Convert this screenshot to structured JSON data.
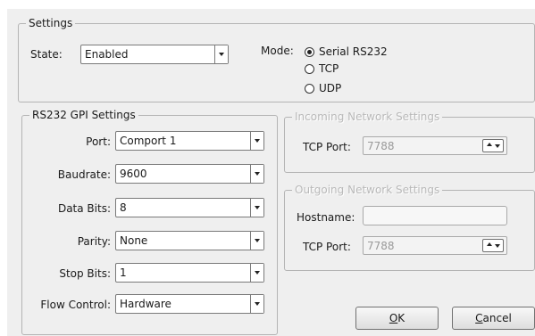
{
  "settings": {
    "legend": "Settings",
    "state_label": "State:",
    "state_value": "Enabled",
    "mode_label": "Mode:",
    "mode_options": [
      "Serial RS232",
      "TCP",
      "UDP"
    ],
    "mode_selected": "Serial RS232"
  },
  "rs232": {
    "legend": "RS232 GPI Settings",
    "fields": [
      {
        "label": "Port:",
        "value": "Comport 1"
      },
      {
        "label": "Baudrate:",
        "value": "9600"
      },
      {
        "label": "Data Bits:",
        "value": "8"
      },
      {
        "label": "Parity:",
        "value": "None"
      },
      {
        "label": "Stop Bits:",
        "value": "1"
      },
      {
        "label": "Flow Control:",
        "value": "Hardware"
      }
    ]
  },
  "incoming": {
    "legend": "Incoming Network Settings",
    "tcp_port_label": "TCP Port:",
    "tcp_port_value": "7788"
  },
  "outgoing": {
    "legend": "Outgoing Network Settings",
    "hostname_label": "Hostname:",
    "hostname_value": "",
    "tcp_port_label": "TCP Port:",
    "tcp_port_value": "7788"
  },
  "buttons": {
    "ok_accel": "O",
    "ok_rest": "K",
    "cancel_accel": "C",
    "cancel_rest": "ancel"
  },
  "icons": {
    "dropdown": "chevron-down-icon",
    "spin": "spin-updown-icon",
    "radio_selected": "radio-selected-icon",
    "radio_empty": "radio-empty-icon"
  },
  "colors": {
    "background": "#efefef",
    "disabled_text": "#b9b9b9",
    "border": "#b4b4b4"
  }
}
